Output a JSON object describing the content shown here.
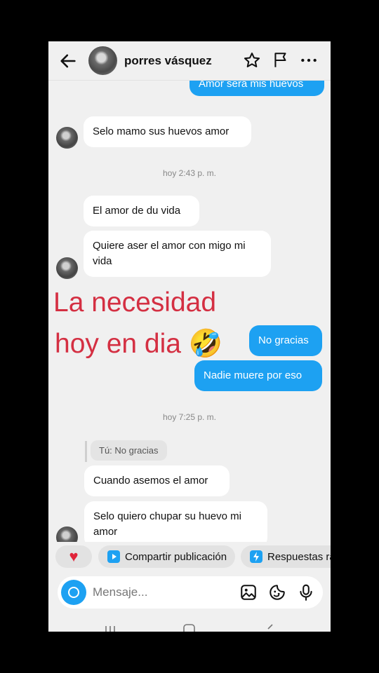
{
  "header": {
    "contact_name": "porres vásquez"
  },
  "messages": {
    "sent_top": "Amor será mis huevos",
    "recv_1": "Selo mamo sus huevos amor",
    "ts_1": "hoy 2:43 p. m.",
    "recv_2": "El amor de du vida",
    "recv_3": "Quiere aser el amor con migo mi vida",
    "sent_1": "No gracias",
    "sent_2": "Nadie muere por eso",
    "ts_2": "hoy 7:25 p. m.",
    "reply_quote": "Tú: No gracias",
    "recv_4": "Cuando asemos el amor",
    "recv_5": "Selo quiero chupar su huevo mi amor"
  },
  "caption": {
    "line1": "La necesidad",
    "line2": "hoy en dia 🤣"
  },
  "quick_replies": {
    "heart": "♥",
    "share": "Compartir publicación",
    "responses": "Respuestas rá"
  },
  "composer": {
    "placeholder": "Mensaje..."
  },
  "colors": {
    "sent_bubble": "#1da1f2",
    "caption": "#d42f42"
  }
}
